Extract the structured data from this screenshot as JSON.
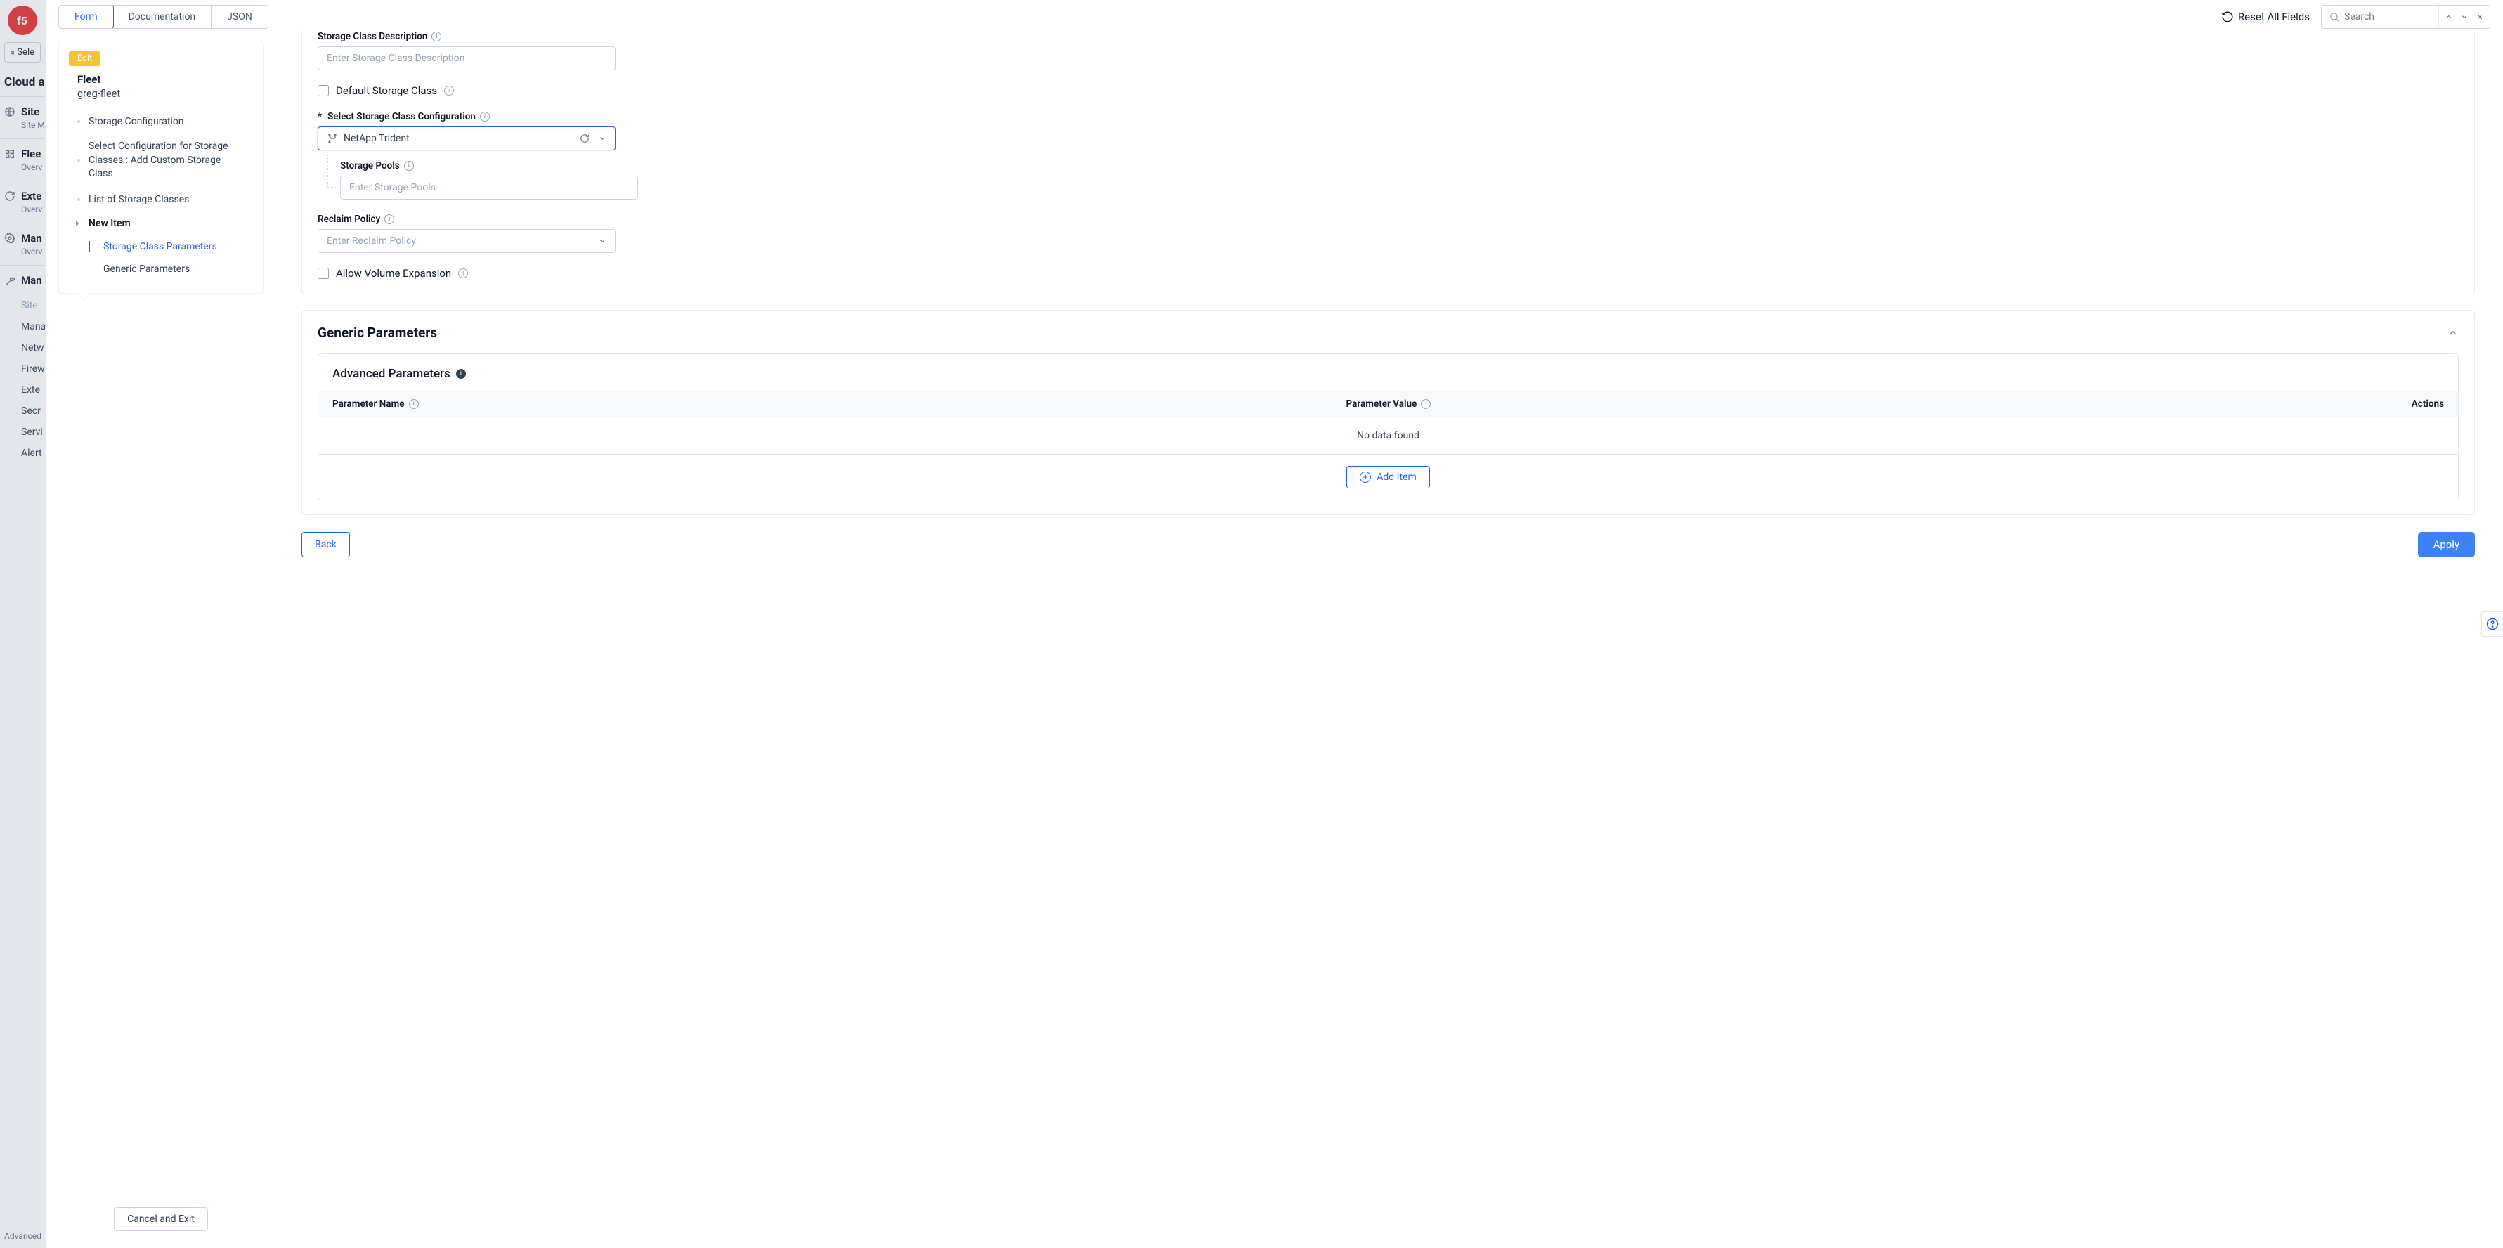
{
  "bgNav": {
    "selectBtn": "Sele",
    "cloudTitle": "Cloud a",
    "sections": [
      {
        "title": "Site",
        "sub": "Site M"
      },
      {
        "title": "Flee",
        "sub": "Overv"
      },
      {
        "title": "Exte",
        "sub": "Overv"
      },
      {
        "title": "Man",
        "sub": "Overv"
      },
      {
        "title": "Man",
        "sub": ""
      }
    ],
    "plainLinks": [
      "Site",
      "Mana",
      "Netw",
      "Firew",
      "Exte",
      "Secr",
      "Servi",
      "Alert"
    ],
    "footer": "Advanced"
  },
  "topbar": {
    "tabs": {
      "form": "Form",
      "documentation": "Documentation",
      "json": "JSON"
    },
    "reset": "Reset All Fields",
    "searchPlaceholder": "Search"
  },
  "sidebar": {
    "editBadge": "Edit",
    "fleetLabel": "Fleet",
    "fleetName": "greg-fleet",
    "items": {
      "storageConfig": "Storage Configuration",
      "selectConfig": "Select Configuration for Storage Classes : Add Custom Storage Class",
      "listClasses": "List of Storage Classes",
      "newItem": "New Item",
      "storageClassParams": "Storage Class Parameters",
      "genericParams": "Generic Parameters"
    },
    "cancel": "Cancel and Exit"
  },
  "form": {
    "storageClassDescription": {
      "label": "Storage Class Description",
      "placeholder": "Enter Storage Class Description"
    },
    "defaultStorageClass": {
      "label": "Default Storage Class"
    },
    "selectStorageClassConfig": {
      "label": "Select Storage Class Configuration",
      "required": "*",
      "value": "NetApp Trident"
    },
    "storagePools": {
      "label": "Storage Pools",
      "placeholder": "Enter Storage Pools"
    },
    "reclaimPolicy": {
      "label": "Reclaim Policy",
      "placeholder": "Enter Reclaim Policy"
    },
    "allowVolumeExpansion": {
      "label": "Allow Volume Expansion"
    }
  },
  "genericSection": {
    "title": "Generic Parameters",
    "subTitle": "Advanced Parameters",
    "columns": {
      "name": "Parameter Name",
      "value": "Parameter Value",
      "actions": "Actions"
    },
    "empty": "No data found",
    "addItem": "Add Item"
  },
  "footer": {
    "back": "Back",
    "apply": "Apply"
  }
}
